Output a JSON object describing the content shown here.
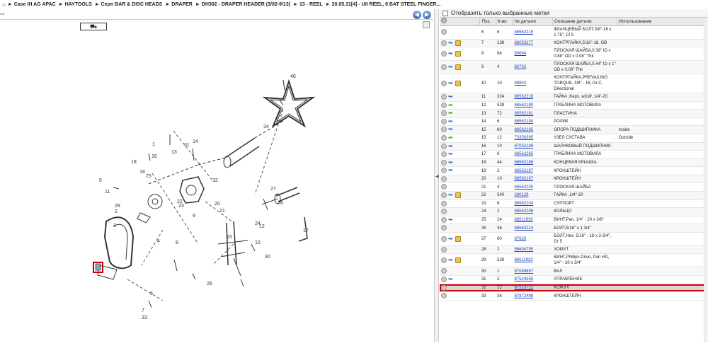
{
  "breadcrumb": [
    "Case IH AG APAC",
    "HAYTOOLS",
    "Серп BAR & DISC HEADS",
    "DRAPER",
    "DH302 - DRAPER HEADER (3/02-9/13)",
    "13 - REEL",
    "20.05.31[4] - UII REEL, 6 BAT STEEL FINGER..."
  ],
  "nav": {
    "back": "◀",
    "forward": "▶"
  },
  "truck_icon": "⛟",
  "filter_label": "Отобразить только выбранные метки",
  "columns": [
    "",
    "Поз.",
    "К-во",
    "№ детали",
    "Описание детали",
    "Использование"
  ],
  "rows": [
    {
      "icons": [
        "info"
      ],
      "pos": "6",
      "qty": "6",
      "part": "86562215",
      "desc": "ФЛАНЦЕВЫЙ БОЛТ,3/8\"-16 x 1.75\", Cl 5",
      "use": ""
    },
    {
      "icons": [
        "info",
        "blue",
        "box"
      ],
      "pos": "7",
      "qty": "138",
      "part": "86050277",
      "desc": "КОНТРГАЙКА,5/16\"-18, GB",
      "use": ""
    },
    {
      "icons": [
        "info",
        "blue",
        "box"
      ],
      "pos": "8",
      "qty": "64",
      "part": "80664",
      "desc": "ПЛОСКАЯ ШАЙБА,0.38\" ID x 0.88\" OD x 0.08\" Thk",
      "use": ""
    },
    {
      "icons": [
        "info",
        "blue",
        "box"
      ],
      "pos": "9",
      "qty": "4",
      "part": "80702",
      "desc": "ПЛОСКАЯ ШАЙБА,0.44\" ID x 1\" OD x 0.08\" Thk",
      "use": ""
    },
    {
      "icons": [
        "info",
        "blue",
        "box"
      ],
      "pos": "10",
      "qty": "10",
      "part": "88902",
      "desc": "КОНТРГАЙКА,PREVAILING TORQUE, 3/8\" - 16, Gr C, Directional",
      "use": ""
    },
    {
      "icons": [
        "info",
        "blue"
      ],
      "pos": "11",
      "qty": "324",
      "part": "86562216",
      "desc": "ГАЙКА ,Keps, w/LW, 1/4\"-20",
      "use": ""
    },
    {
      "icons": [
        "info",
        "green"
      ],
      "pos": "12",
      "qty": "528",
      "part": "86562180",
      "desc": "ГРАБЛИНА МОТОВИЛА",
      "use": ""
    },
    {
      "icons": [
        "info",
        "green"
      ],
      "pos": "13",
      "qty": "72",
      "part": "86562181",
      "desc": "ПЛАСТИНА",
      "use": ""
    },
    {
      "icons": [
        "info",
        "blue"
      ],
      "pos": "14",
      "qty": "6",
      "part": "86562184",
      "desc": "РОЛИК",
      "use": ""
    },
    {
      "icons": [
        "info",
        "blue"
      ],
      "pos": "15",
      "qty": "60",
      "part": "86562185",
      "desc": "ОПОРА ПОДШИПНИКА",
      "use": "Inside"
    },
    {
      "icons": [
        "info",
        "green"
      ],
      "pos": "15",
      "qty": "12",
      "part": "73356395",
      "desc": "УЗЕЛ СУСТАВА",
      "use": "Outside"
    },
    {
      "icons": [
        "info",
        "blue"
      ],
      "pos": "16",
      "qty": "10",
      "part": "87052189",
      "desc": "ШАРИКОВЫЙ ПОДШИПНИК",
      "use": ""
    },
    {
      "icons": [
        "info",
        "blue"
      ],
      "pos": "17",
      "qty": "6",
      "part": "86562265",
      "desc": "ГРАБЛИНА МОТОВИЛА",
      "use": ""
    },
    {
      "icons": [
        "info",
        "blue"
      ],
      "pos": "18",
      "qty": "44",
      "part": "86562186",
      "desc": "КОНЦЕВАЯ КРЫШКА",
      "use": ""
    },
    {
      "icons": [
        "info",
        "blue"
      ],
      "pos": "19",
      "qty": "2",
      "part": "86562187",
      "desc": "КРОНШТЕЙН",
      "use": ""
    },
    {
      "icons": [
        "info"
      ],
      "pos": "20",
      "qty": "10",
      "part": "86562197",
      "desc": "КРОНШТЕЙН",
      "use": ""
    },
    {
      "icons": [
        "info"
      ],
      "pos": "21",
      "qty": "4",
      "part": "86562200",
      "desc": "ПЛОСКАЯ ШАЙБА",
      "use": ""
    },
    {
      "icons": [
        "info",
        "blue",
        "box"
      ],
      "pos": "22",
      "qty": "540",
      "part": "280129",
      "desc": "ГАЙКА ,1/4\"-20",
      "use": ""
    },
    {
      "icons": [
        "info"
      ],
      "pos": "23",
      "qty": "6",
      "part": "86562204",
      "desc": "СУППОРТ",
      "use": ""
    },
    {
      "icons": [
        "info"
      ],
      "pos": "24",
      "qty": "2",
      "part": "86562206",
      "desc": "КОЛЬЦО",
      "use": ""
    },
    {
      "icons": [
        "info",
        "blue"
      ],
      "pos": "25",
      "qty": "24",
      "part": "86511930",
      "desc": "ВИНТ,Pan, 1/4\" - 20 x 3/8\"",
      "use": ""
    },
    {
      "icons": [
        "info"
      ],
      "pos": "26",
      "qty": "36",
      "part": "86562214",
      "desc": "БОЛТ,5/16\" x 1 3/4\"",
      "use": ""
    },
    {
      "icons": [
        "info",
        "blue",
        "box"
      ],
      "pos": "27",
      "qty": "60",
      "part": "87626",
      "desc": "БОЛТ,Hex, 5/16\" - 18 x 2-3/4\", Gr 5",
      "use": ""
    },
    {
      "icons": [
        "info"
      ],
      "pos": "28",
      "qty": "2",
      "part": "86604795",
      "desc": "ХОМУТ",
      "use": ""
    },
    {
      "icons": [
        "info",
        "blue",
        "box"
      ],
      "pos": "29",
      "qty": "528",
      "part": "86511932",
      "desc": "ВИНТ,Phillips Drive, Pan HD, 1/4\" - 20 x 3/4\"",
      "use": ""
    },
    {
      "icons": [
        "info"
      ],
      "pos": "30",
      "qty": "1",
      "part": "87048897",
      "desc": "ВАЛ",
      "use": ""
    },
    {
      "icons": [
        "info",
        "blue"
      ],
      "pos": "31",
      "qty": "2",
      "part": "87524555",
      "desc": "УПРАВЛЕНИЕ",
      "use": ""
    },
    {
      "icons": [
        "info"
      ],
      "pos": "32",
      "qty": "12",
      "part": "87523722",
      "desc": "КОЖУХ",
      "use": "",
      "selected": true
    },
    {
      "icons": [
        "info"
      ],
      "pos": "33",
      "qty": "36",
      "part": "87872498",
      "desc": "КРОНШТЕЙН",
      "use": ""
    }
  ],
  "drawing_labels": [
    "40",
    "34",
    "1",
    "31",
    "14",
    "13",
    "16",
    "19",
    "18",
    "25",
    "11",
    "29",
    "22",
    "32",
    "9",
    "4",
    "17",
    "27",
    "28",
    "3",
    "2",
    "5",
    "20",
    "23",
    "21",
    "24",
    "26",
    "12",
    "10",
    "15",
    "30",
    "8",
    "6",
    "7",
    "33"
  ]
}
